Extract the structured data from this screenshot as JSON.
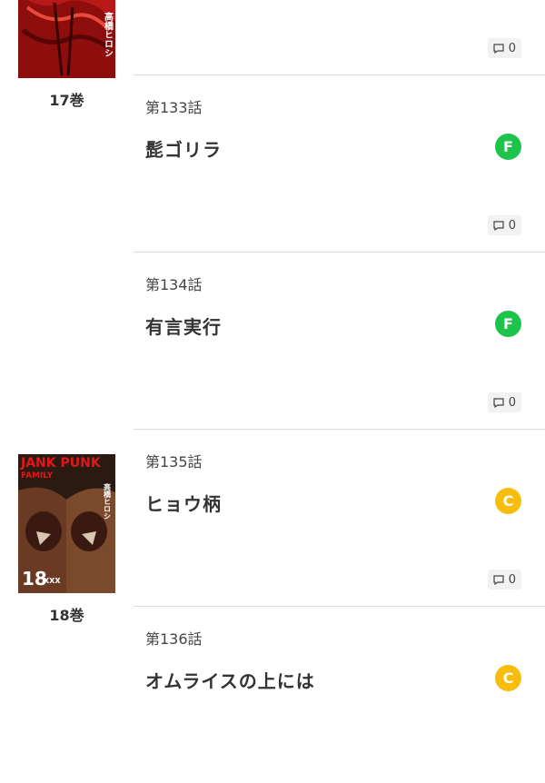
{
  "volumes": [
    {
      "label": "17巻",
      "cover_text": "高橋ヒロシ"
    },
    {
      "label": "18巻",
      "cover_title": "JANK PUNK",
      "cover_subtitle": "FAMILY",
      "cover_author": "高橋ヒロシ",
      "cover_number": "18",
      "cover_mark": "XXX"
    }
  ],
  "episodes": [
    {
      "comments": "0"
    },
    {
      "number": "第133話",
      "title": "髭ゴリラ",
      "badge": "F",
      "comments": "0"
    },
    {
      "number": "第134話",
      "title": "有言実行",
      "badge": "F",
      "comments": "0"
    },
    {
      "number": "第135話",
      "title": "ヒョウ柄",
      "badge": "C",
      "comments": "0"
    },
    {
      "number": "第136話",
      "title": "オムライスの上には",
      "badge": "C"
    }
  ],
  "colors": {
    "free_badge": "#1dc34a",
    "coin_badge": "#f7bd0c"
  }
}
